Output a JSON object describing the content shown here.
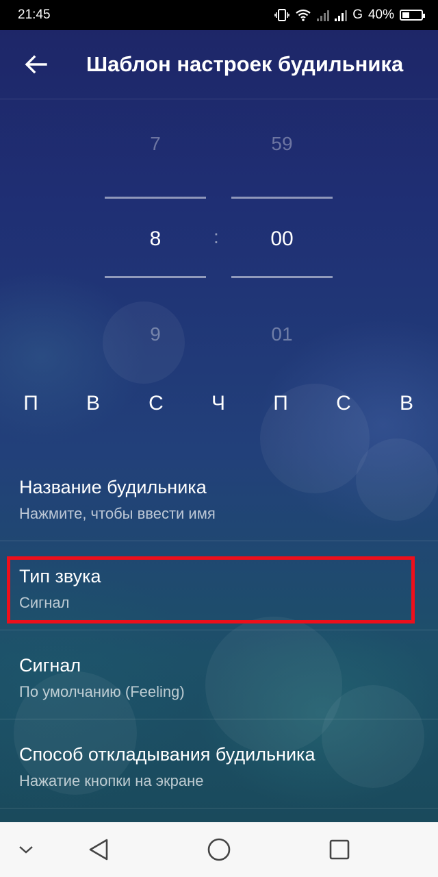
{
  "status_bar": {
    "time": "21:45",
    "network": "G",
    "battery": "40%",
    "battery_level": 0.4,
    "icons": [
      "vibrate-icon",
      "wifi-icon",
      "signal-icon",
      "signal-icon",
      "battery-icon"
    ]
  },
  "app_bar": {
    "back_icon": "arrow-left-icon",
    "title": "Шаблон настроек будильника"
  },
  "time_picker": {
    "hours": {
      "prev": "7",
      "selected": "8",
      "next": "9"
    },
    "separator": ":",
    "minutes": {
      "prev": "59",
      "selected": "00",
      "next": "01"
    }
  },
  "days": [
    "П",
    "В",
    "С",
    "Ч",
    "П",
    "С",
    "В"
  ],
  "settings": [
    {
      "title": "Название будильника",
      "subtitle": "Нажмите, чтобы ввести имя"
    },
    {
      "title": "Тип звука",
      "subtitle": "Сигнал"
    },
    {
      "title": "Сигнал",
      "subtitle": "По умолчанию (Feeling)"
    },
    {
      "title": "Способ откладывания будильника",
      "subtitle": "Нажатие кнопки на экране"
    }
  ],
  "highlight_color": "#ee0f1b",
  "nav_bar": {
    "icons": [
      "chevron-down-icon",
      "back-triangle-icon",
      "home-circle-icon",
      "recents-square-icon"
    ]
  }
}
